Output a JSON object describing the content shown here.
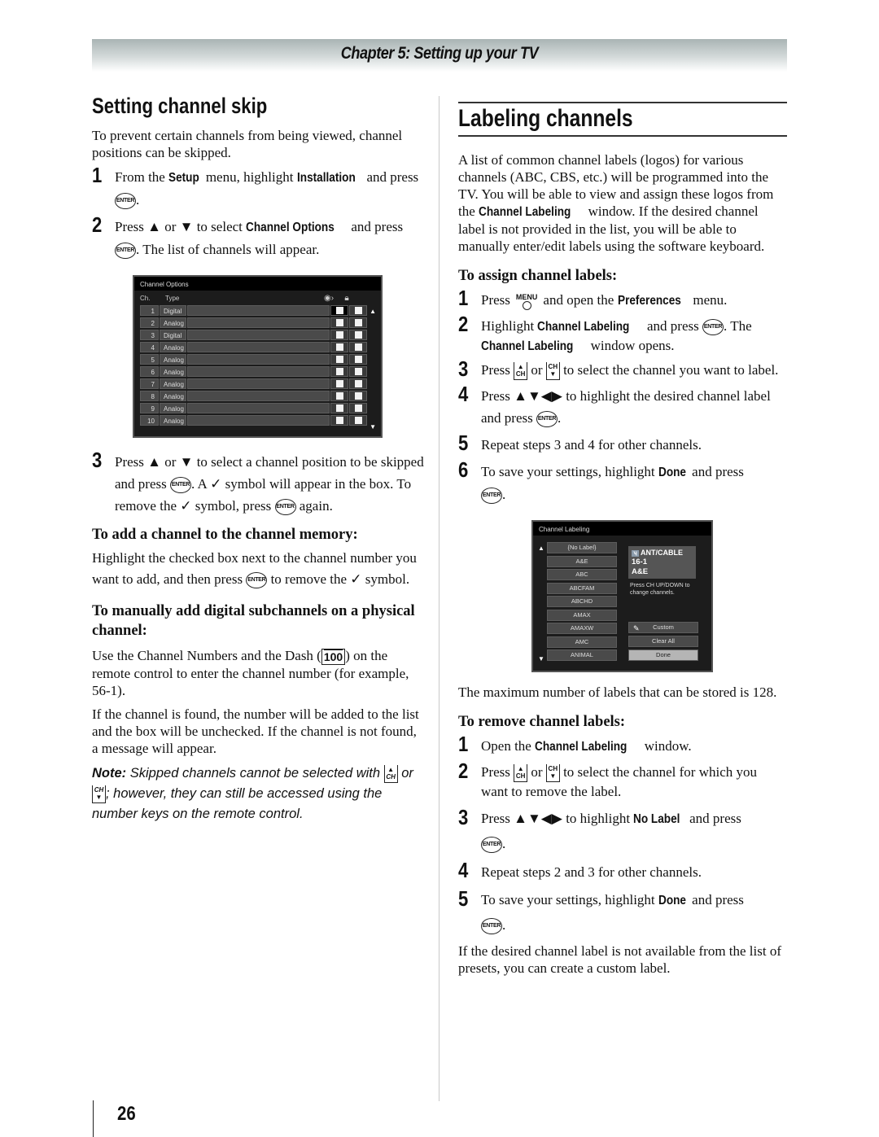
{
  "header": {
    "chapter_title": "Chapter 5: Setting up your TV"
  },
  "left": {
    "title": "Setting channel skip",
    "intro": "To prevent certain channels from being viewed, channel positions can be skipped.",
    "steps": [
      {
        "num": "1",
        "a": "From the ",
        "kw1": "Setup",
        "b": " menu, highlight ",
        "kw2": "Installation",
        "c": " and press ",
        "d": "."
      },
      {
        "num": "2",
        "a": "Press ▲ or ▼ to select ",
        "kw1": "Channel Options",
        "b": " and press ",
        "c": ". The list of channels will appear."
      },
      {
        "num": "3",
        "a": "Press ▲ or ▼ to select a channel position to be skipped and press ",
        "b": ". A ✓ symbol will appear in the box. To remove the ✓ symbol, press ",
        "c": " again."
      }
    ],
    "channel_options_screen": {
      "title": "Channel Options",
      "col_ch": "Ch.",
      "col_type": "Type",
      "skip_icon": "eye-skip-icon",
      "lock_icon": "lock-icon",
      "rows": [
        {
          "ch": "1",
          "type": "Digital",
          "selected": true
        },
        {
          "ch": "2",
          "type": "Analog"
        },
        {
          "ch": "3",
          "type": "Digital"
        },
        {
          "ch": "4",
          "type": "Analog"
        },
        {
          "ch": "5",
          "type": "Analog"
        },
        {
          "ch": "6",
          "type": "Analog"
        },
        {
          "ch": "7",
          "type": "Analog"
        },
        {
          "ch": "8",
          "type": "Analog"
        },
        {
          "ch": "9",
          "type": "Analog"
        },
        {
          "ch": "10",
          "type": "Analog"
        }
      ]
    },
    "add_heading": "To add a channel to the channel memory:",
    "add_text_a": "Highlight the checked box next to the channel number you want to add, and then press ",
    "add_text_b": " to remove the ✓ symbol.",
    "sub_heading": "To manually add digital subchannels on a physical channel:",
    "sub_text_a": "Use the Channel Numbers and the Dash (",
    "sub_text_b": ") on the remote control to enter the channel number (for example, 56-1).",
    "found_text": "If the channel is found, the number will be added to the list and the box will be unchecked. If the channel is not found, a message will appear.",
    "note_label": "Note:",
    "note_a": " Skipped channels cannot be selected with ",
    "note_or": " or ",
    "note_b": "; however, they can still be accessed using the number keys on the remote control."
  },
  "right": {
    "title": "Labeling channels",
    "intro_a": "A list of common channel labels (logos) for various channels (ABC, CBS, etc.) will be programmed into the TV. You will be able to view and assign these logos from the ",
    "intro_kw": "Channel Labeling",
    "intro_b": " window. If the desired channel label is not provided in the list, you will be able to manually enter/edit labels using the software keyboard.",
    "assign_heading": "To assign channel labels:",
    "assign_steps": [
      {
        "num": "1",
        "a": "Press ",
        "b": " and open the ",
        "kw1": "Preferences",
        "c": " menu."
      },
      {
        "num": "2",
        "a": "Highlight ",
        "kw1": "Channel Labeling",
        "b": " and press ",
        "c": ". The ",
        "kw2": "Channel Labeling",
        "d": " window opens."
      },
      {
        "num": "3",
        "a": "Press ",
        "or": " or ",
        "b": " to select the channel you want to label."
      },
      {
        "num": "4",
        "a": "Press ▲▼◀▶ to highlight the desired channel label and press ",
        "b": "."
      },
      {
        "num": "5",
        "a": "Repeat steps 3 and 4 for other channels."
      },
      {
        "num": "6",
        "a": "To save your settings, highlight ",
        "kw1": "Done",
        "b": " and press ",
        "c": "."
      }
    ],
    "channel_labeling_screen": {
      "title": "Channel Labeling",
      "labels": [
        "{No Label}",
        "A&E",
        "ABC",
        "ABCFAM",
        "ABCHD",
        "AMAX",
        "AMAXW",
        "AMC",
        "ANIMAL"
      ],
      "info_source": "ANT/CABLE",
      "info_channel": "16-1",
      "info_label": "A&E",
      "help": "Press CH UP/DOWN to change channels.",
      "buttons": {
        "custom": "Custom",
        "clear_all": "Clear All",
        "done": "Done"
      }
    },
    "max_text": "The maximum number of labels that can be stored is 128.",
    "remove_heading": "To remove channel labels:",
    "remove_steps": [
      {
        "num": "1",
        "a": "Open the ",
        "kw1": "Channel Labeling",
        "b": " window."
      },
      {
        "num": "2",
        "a": "Press ",
        "or": " or ",
        "b": " to select the channel for which you want to remove the label."
      },
      {
        "num": "3",
        "a": "Press ▲▼◀▶ to highlight ",
        "kw1": "No Label",
        "b": " and press ",
        "c": "."
      },
      {
        "num": "4",
        "a": "Repeat steps 2 and 3 for other channels."
      },
      {
        "num": "5",
        "a": "To save your settings, highlight ",
        "kw1": "Done",
        "b": " and press ",
        "c": "."
      }
    ],
    "custom_text": "If the desired channel label is not available from the list of presets, you can create a custom label."
  },
  "icons": {
    "enter": "ENTER",
    "menu": "MENU",
    "ch": "CH",
    "hundred": "100"
  },
  "footer": {
    "page_number": "26"
  }
}
